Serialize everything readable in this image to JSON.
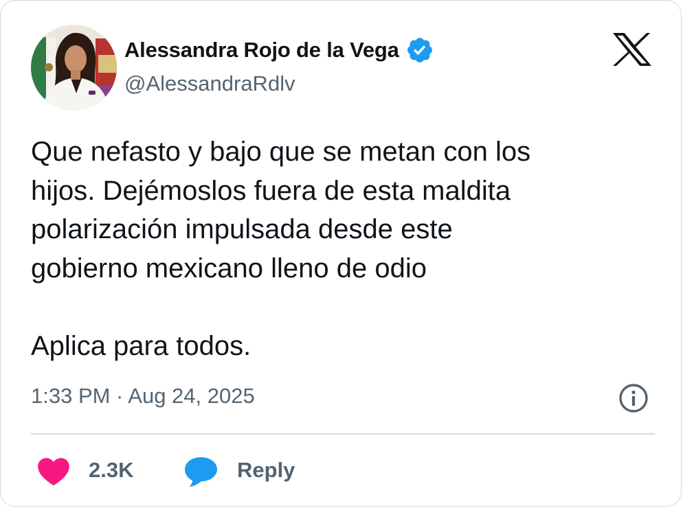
{
  "author": {
    "display_name": "Alessandra Rojo de la Vega",
    "handle": "@AlessandraRdlv",
    "verified": true
  },
  "tweet": {
    "paragraphs": [
      "Que nefasto y bajo que se metan con los\nhijos. Dejémoslos fuera de esta maldita\npolarización impulsada desde este\ngobierno mexicano lleno de odio",
      "Aplica para todos."
    ],
    "timestamp": "1:33 PM · Aug 24, 2025"
  },
  "actions": {
    "like_count": "2.3K",
    "reply_label": "Reply"
  },
  "icons": {
    "brand": "x-logo-icon",
    "verified": "verified-badge-icon",
    "info": "info-icon",
    "like": "heart-icon",
    "reply": "speech-bubble-icon"
  },
  "colors": {
    "text_primary": "#0f1419",
    "text_secondary": "#536471",
    "verified_blue": "#1d9bf0",
    "like_pink": "#f91880",
    "reply_blue": "#1d9bf0",
    "border": "#cfd9de"
  }
}
